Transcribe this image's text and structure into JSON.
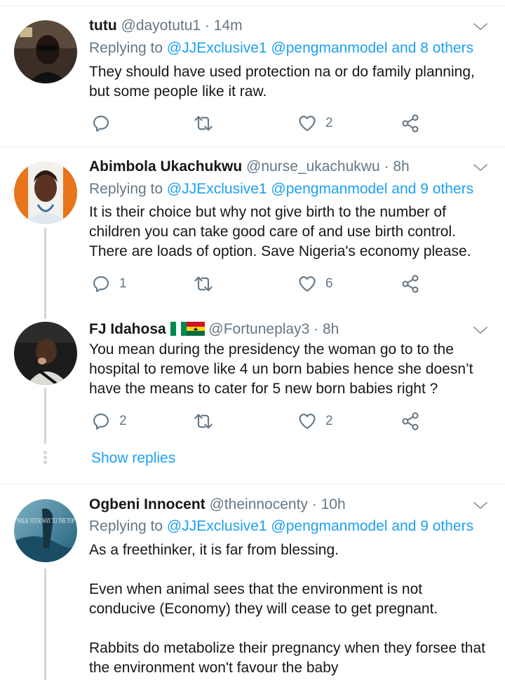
{
  "tweets": [
    {
      "name": "tutu",
      "handle": "@dayotutu1",
      "dot": "·",
      "time": "14m",
      "replying_prefix": "Replying to",
      "mentions": "@JJExclusive1 @pengmanmodel and 8 others",
      "text": [
        "They should have used protection na or do family planning, but some people like it raw."
      ],
      "reply_count": "",
      "like_count": "2"
    },
    {
      "name": "Abimbola Ukachukwu",
      "handle": "@nurse_ukachukwu",
      "dot": "·",
      "time": "8h",
      "replying_prefix": "Replying to",
      "mentions": "@JJExclusive1 @pengmanmodel and 9 others",
      "text": [
        "It is their choice but why not give birth to the number of children you can take good care of and use birth control. There are loads of option. Save Nigeria's economy please."
      ],
      "reply_count": "1",
      "like_count": "6"
    },
    {
      "name": "FJ Idahosa",
      "handle": "@Fortuneplay3",
      "dot": "·",
      "time": "8h",
      "text": [
        "You mean during the presidency the woman go to to the hospital to remove like 4 un born babies hence she doesn’t have the means to cater for 5 new born babies right ?"
      ],
      "reply_count": "2",
      "like_count": "2"
    },
    {
      "name": "Ogbeni Innocent",
      "handle": "@theinnocenty",
      "dot": "·",
      "time": "10h",
      "replying_prefix": "Replying to",
      "mentions": "@JJExclusive1 @pengmanmodel and 9 others",
      "text": [
        "As a freethinker, it is far from blessing.",
        "Even when animal sees that the environment is not conducive (Economy) they will cease to get pregnant.",
        "Rabbits do metabolize their pregnancy when they forsee that the environment won't favour the baby"
      ],
      "avatar_text": "WALK YOUR WAY TO THE TOP"
    }
  ],
  "show_replies": "Show replies",
  "icons": [
    "reply-icon",
    "retweet-icon",
    "like-icon",
    "share-icon",
    "chevron-down-icon",
    "nigeria-flag-icon",
    "ghana-flag-icon"
  ],
  "colors": {
    "accent": "#1da1f2",
    "muted": "#657786",
    "text": "#14171a",
    "divider": "#e6ecf0"
  }
}
